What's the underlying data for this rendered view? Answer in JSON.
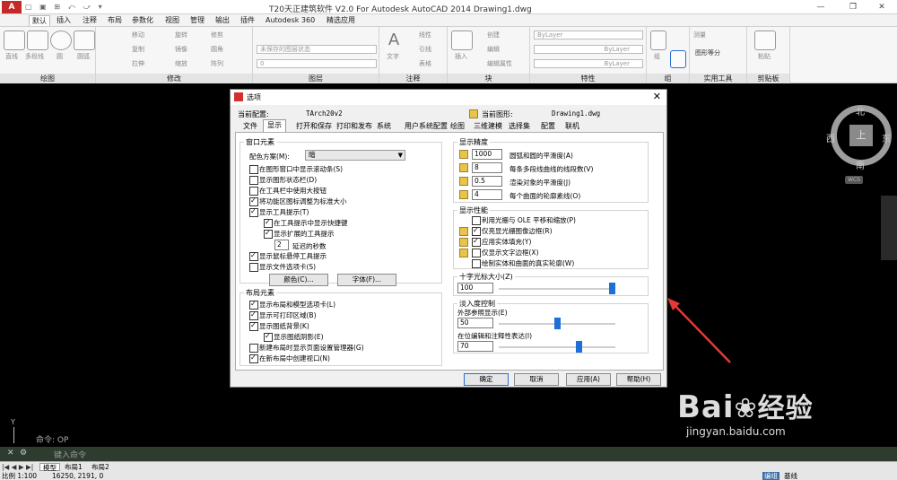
{
  "app": {
    "title": "T20天正建筑软件 V2.0 For Autodesk AutoCAD 2014    Drawing1.dwg",
    "icon_text": "A"
  },
  "menubar": {
    "tabs": [
      "默认",
      "插入",
      "注释",
      "布局",
      "参数化",
      "视图",
      "管理",
      "输出",
      "插件",
      "Autodesk 360",
      "精选应用"
    ]
  },
  "ribbon": {
    "groups": [
      "绘图",
      "修改",
      "图层",
      "注释",
      "块",
      "特性",
      "组",
      "实用工具",
      "剪贴板"
    ],
    "draw_tools": [
      "直线",
      "多段线",
      "圆",
      "圆弧"
    ],
    "modify_tools": [
      "移动",
      "旋转",
      "修剪",
      "复制",
      "镜像",
      "圆角",
      "拉伸",
      "缩放",
      "阵列"
    ],
    "layer_state": "未保存的图层状态",
    "layer_current": "0",
    "annot_tools": [
      "文字",
      "线性",
      "引线",
      "表格"
    ],
    "block_tools": [
      "插入",
      "创建",
      "编辑",
      "编辑属性"
    ],
    "prop_values": [
      "ByLayer",
      "ByLayer",
      "ByLayer"
    ],
    "util_tools": [
      "测量",
      "组"
    ],
    "clip_tools": [
      "粘贴"
    ],
    "util_label": "图形等分"
  },
  "dialog": {
    "title": "选项",
    "close": "✕",
    "current_config_label": "当前配置:",
    "current_config": "TArch20v2",
    "current_drawing_label": "当前图形:",
    "current_drawing": "Drawing1.dwg",
    "tabs": [
      "文件",
      "显示",
      "打开和保存",
      "打印和发布",
      "系统",
      "用户系统配置",
      "绘图",
      "三维建模",
      "选择集",
      "配置",
      "联机"
    ],
    "window_elements": {
      "legend": "窗口元素",
      "color_scheme_label": "配色方案(M):",
      "color_scheme": "暗",
      "checks": [
        {
          "label": "在图形窗口中显示滚动条(S)",
          "on": false
        },
        {
          "label": "显示图形状态栏(D)",
          "on": false
        },
        {
          "label": "在工具栏中使用大按钮",
          "on": false
        },
        {
          "label": "将功能区图标调整为标准大小",
          "on": true
        },
        {
          "label": "显示工具提示(T)",
          "on": true
        },
        {
          "label": "在工具提示中显示快捷键",
          "on": true
        },
        {
          "label": "显示扩展的工具提示",
          "on": true
        },
        {
          "label": "显示鼠标悬停工具提示",
          "on": true
        },
        {
          "label": "显示文件选项卡(S)",
          "on": false
        }
      ],
      "delay_value": "2",
      "delay_label": "延迟的秒数",
      "colors_button": "颜色(C)...",
      "fonts_button": "字体(F)..."
    },
    "layout_elements": {
      "legend": "布局元素",
      "checks": [
        {
          "label": "显示布局和模型选项卡(L)",
          "on": true
        },
        {
          "label": "显示可打印区域(B)",
          "on": true
        },
        {
          "label": "显示图纸背景(K)",
          "on": true
        },
        {
          "label": "显示图纸阴影(E)",
          "on": true
        },
        {
          "label": "新建布局时显示页面设置管理器(G)",
          "on": false
        },
        {
          "label": "在新布局中创建视口(N)",
          "on": true
        }
      ]
    },
    "display_resolution": {
      "legend": "显示精度",
      "rows": [
        {
          "value": "1000",
          "label": "圆弧和圆的平滑度(A)"
        },
        {
          "value": "8",
          "label": "每条多段线曲线的线段数(V)"
        },
        {
          "value": "0.5",
          "label": "渲染对象的平滑度(J)"
        },
        {
          "value": "4",
          "label": "每个曲面的轮廓素线(O)"
        }
      ]
    },
    "display_performance": {
      "legend": "显示性能",
      "checks": [
        {
          "label": "利用光栅与 OLE 平移和缩放(P)",
          "on": false
        },
        {
          "label": "仅亮显光栅图像边框(R)",
          "on": true
        },
        {
          "label": "应用实体填充(Y)",
          "on": true
        },
        {
          "label": "仅显示文字边框(X)",
          "on": false
        },
        {
          "label": "绘制实体和曲面的真实轮廓(W)",
          "on": false
        }
      ]
    },
    "crosshair": {
      "legend": "十字光标大小(Z)",
      "value": "100",
      "level": 1.0
    },
    "fade": {
      "legend": "淡入度控制",
      "xref_label": "外部参照显示(E)",
      "xref_value": "50",
      "xref_level": 0.5,
      "inplace_label": "在位编辑和注释性表达(I)",
      "inplace_value": "70",
      "inplace_level": 0.7
    },
    "buttons": {
      "ok": "确定",
      "cancel": "取消",
      "apply": "应用(A)",
      "help": "帮助(H)"
    }
  },
  "viewcube": {
    "north": "北",
    "south": "南",
    "west": "西",
    "east": "东",
    "top": "上",
    "wcs": "WCS"
  },
  "command": {
    "last": "命令: OP",
    "prompt": "键入命令"
  },
  "statusbar": {
    "tabs": [
      "模型",
      "布局1",
      "布局2"
    ],
    "scale": "比例 1:100",
    "coords": "16250, 2191, 0",
    "right_labels": [
      "编组",
      "基线"
    ]
  },
  "watermark": {
    "brand": "Bai",
    "brand2": "经验",
    "url": "jingyan.baidu.com"
  },
  "colors": {
    "accent": "#1c70d8",
    "arrow": "#e53935",
    "canvas": "#000000"
  }
}
